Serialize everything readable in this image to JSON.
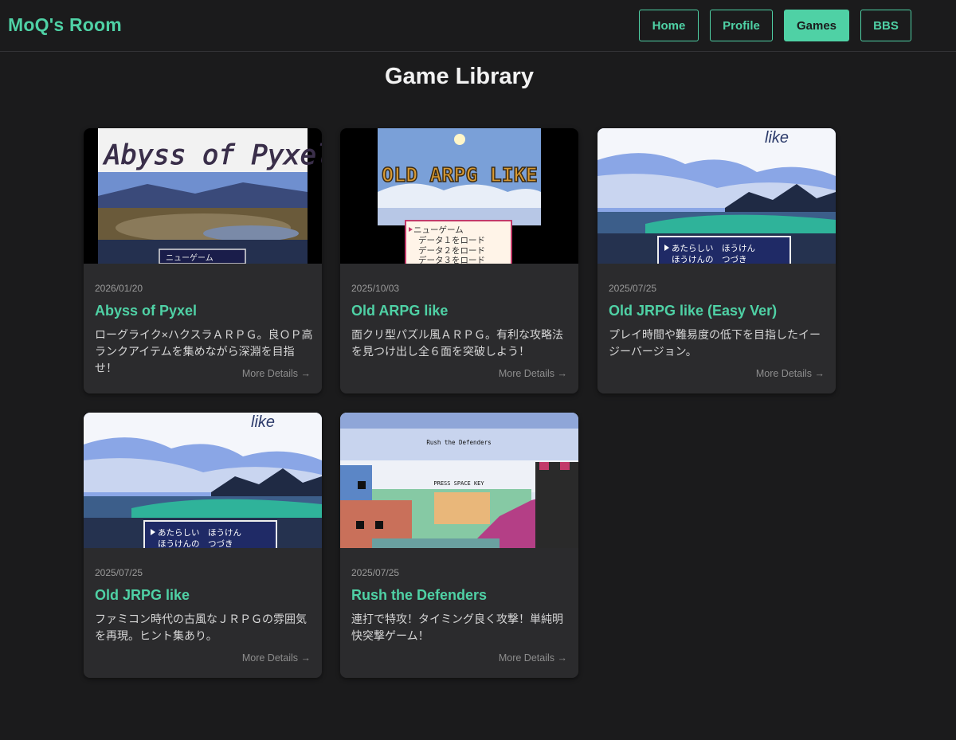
{
  "header": {
    "brand": "MoQ's Room",
    "nav": [
      {
        "label": "Home"
      },
      {
        "label": "Profile"
      },
      {
        "label": "Games",
        "active": true
      },
      {
        "label": "BBS"
      }
    ]
  },
  "page": {
    "title": "Game Library"
  },
  "colors": {
    "accent": "#4fd1a5",
    "background": "#1b1b1c",
    "card": "#2b2b2d"
  },
  "games": [
    {
      "date": "2026/01/20",
      "title": "Abyss of Pyxel",
      "description": "ローグライク×ハクスラＡＲＰＧ。良ＯＰ高ランクアイテムを集めながら深淵を目指せ！",
      "more": "More Details →",
      "thumb": {
        "title_art": "Abyss of Pyxel",
        "menu": [
          "ニューゲーム"
        ]
      }
    },
    {
      "date": "2025/10/03",
      "title": "Old ARPG like",
      "description": "面クリ型パズル風ＡＲＰＧ。有利な攻略法を見つけ出し全６面を突破しよう！",
      "more": "More Details →",
      "thumb": {
        "title_art": "OLD ARPG LIKE",
        "menu": [
          "ニューゲーム",
          "データ１をロード",
          "データ２をロード",
          "データ３をロード"
        ]
      }
    },
    {
      "date": "2025/07/25",
      "title": "Old JRPG like (Easy Ver)",
      "description": "プレイ時間や難易度の低下を目指したイージーバージョン。",
      "more": "More Details →",
      "thumb": {
        "title_art": "like",
        "menu": [
          "あたらしい　ほうけん",
          "ほうけんの　つづき"
        ]
      }
    },
    {
      "date": "2025/07/25",
      "title": "Old JRPG like",
      "description": "ファミコン時代の古風なＪＲＰＧの雰囲気を再現。ヒント集あり。",
      "more": "More Details →",
      "thumb": {
        "title_art": "like",
        "menu": [
          "あたらしい　ほうけん",
          "ほうけんの　つづき"
        ]
      }
    },
    {
      "date": "2025/07/25",
      "title": "Rush the Defenders",
      "description": "連打で特攻！タイミング良く攻撃！単純明快突撃ゲーム！",
      "more": "More Details →",
      "thumb": {
        "title_art": "Rush the Defenders",
        "prompt": "PRESS SPACE KEY"
      }
    }
  ]
}
